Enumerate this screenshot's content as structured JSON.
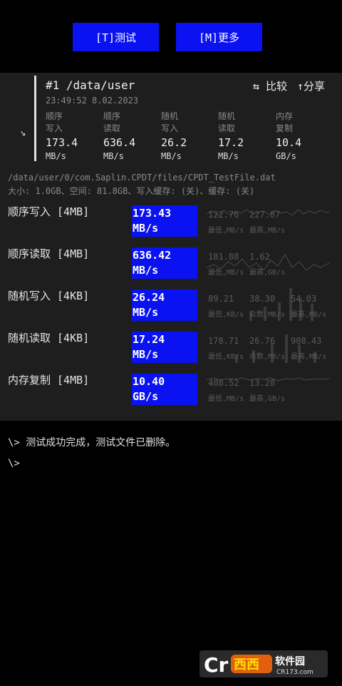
{
  "toolbar": {
    "test_label": "[T]测试",
    "more_label": "[M]更多"
  },
  "summary": {
    "title": "#1 /data/user",
    "timestamp": "23:49:52 8.02.2023",
    "compare_label": "⇆ 比较",
    "share_label": "↑分享",
    "expand_glyph": "↘",
    "stats": [
      {
        "l1": "顺序",
        "l2": "写入",
        "value": "173.4",
        "unit": "MB/s"
      },
      {
        "l1": "顺序",
        "l2": "读取",
        "value": "636.4",
        "unit": "MB/s"
      },
      {
        "l1": "随机",
        "l2": "写入",
        "value": "26.2",
        "unit": "MB/s"
      },
      {
        "l1": "随机",
        "l2": "读取",
        "value": "17.2",
        "unit": "MB/s"
      },
      {
        "l1": "内存",
        "l2": "复制",
        "value": "10.4",
        "unit": "GB/s"
      }
    ]
  },
  "file": {
    "path": "/data/user/0/com.Saplin.CPDT/files/CPDT_TestFile.dat",
    "meta": "大小: 1.0GB、空间: 81.8GB、写入缓存: (关)、缓存: (关)"
  },
  "results": [
    {
      "name": "顺序写入 [4MB]",
      "v1": "173.43",
      "v2": "MB/s",
      "m": [
        {
          "value": "122.76",
          "label": "最低,MB/s"
        },
        {
          "value": "227.87",
          "label": "最高,MB/s"
        }
      ]
    },
    {
      "name": "顺序读取 [4MB]",
      "v1": "636.42",
      "v2": "MB/s",
      "m": [
        {
          "value": "181.88",
          "label": "最低,MB/s"
        },
        {
          "value": "1.62",
          "label": "最高,GB/s"
        }
      ]
    },
    {
      "name": "随机写入 [4KB]",
      "v1": "26.24",
      "v2": "MB/s",
      "m": [
        {
          "value": "89.21",
          "label": "最低,KB/s"
        },
        {
          "value": "38.30",
          "label": "众数,MB/s"
        },
        {
          "value": "54.03",
          "label": "最高,MB/s"
        }
      ]
    },
    {
      "name": "随机读取 [4KB]",
      "v1": "17.24",
      "v2": "MB/s",
      "m": [
        {
          "value": "178.71",
          "label": "最低,KB/s"
        },
        {
          "value": "26.76",
          "label": "众数,MB/s"
        },
        {
          "value": "908.43",
          "label": "最高,MB/s"
        }
      ]
    },
    {
      "name": "内存复制 [4MB]",
      "v1": "10.40",
      "v2": "GB/s",
      "m": [
        {
          "value": "408.52",
          "label": "最低,MB/s"
        },
        {
          "value": "13.28",
          "label": "最高,GB/s"
        }
      ]
    }
  ],
  "console": {
    "line1": "\\> 测试成功完成，测试文件已删除。",
    "line2": "\\>"
  },
  "watermark": {
    "brand": "Cr",
    "cn": "西西",
    "cn2": "软件园",
    "site": "CR173.com"
  },
  "colors": {
    "accent": "#0a12f2",
    "panel": "#1e1e1e"
  }
}
